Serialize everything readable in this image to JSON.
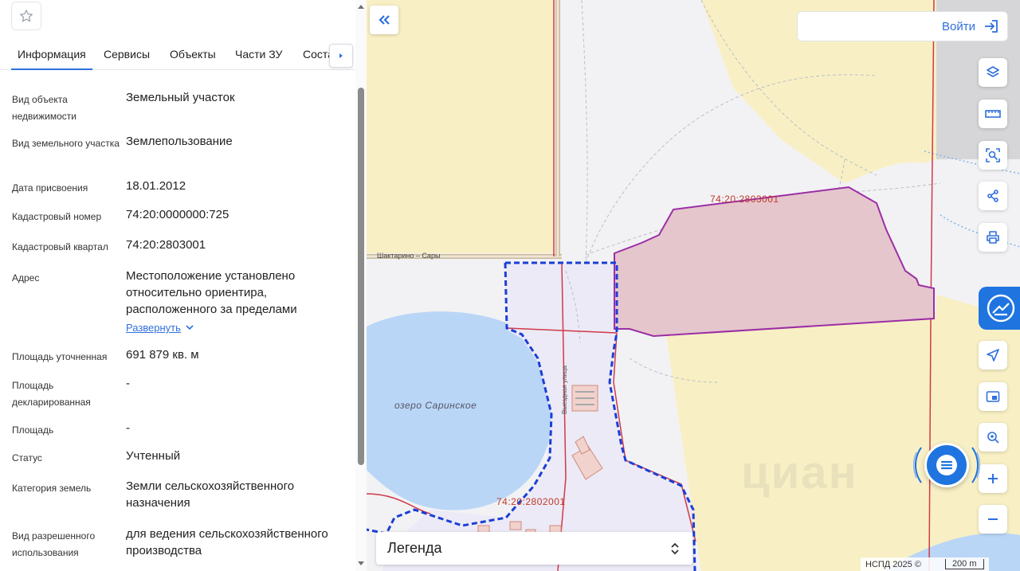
{
  "panel": {
    "tabs": [
      {
        "label": "Информация",
        "active": true
      },
      {
        "label": "Сервисы",
        "active": false
      },
      {
        "label": "Объекты",
        "active": false
      },
      {
        "label": "Части ЗУ",
        "active": false
      },
      {
        "label": "Соста",
        "active": false
      }
    ],
    "rows": [
      {
        "label": "Вид объекта недвижимости",
        "value": "Земельный участок"
      },
      {
        "label": "Вид земельного участка",
        "value": "Землепользование"
      },
      {
        "label": "Дата присвоения",
        "value": "18.01.2012"
      },
      {
        "label": "Кадастровый номер",
        "value": "74:20:0000000:725"
      },
      {
        "label": "Кадастровый квартал",
        "value": "74:20:2803001"
      },
      {
        "label": "Адрес",
        "value": "Местоположение установлено относительно ориентира, расположенного за пределами",
        "expand_label": "Развернуть"
      },
      {
        "label": "Площадь уточненная",
        "value": "691 879 кв. м"
      },
      {
        "label": "Площадь декларированная",
        "value": "-"
      },
      {
        "label": "Площадь",
        "value": "-"
      },
      {
        "label": "Статус",
        "value": "Учтенный"
      },
      {
        "label": "Категория земель",
        "value": "Земли сельскохозяйственного назначения"
      },
      {
        "label": "Вид разрешенного использования",
        "value": "для ведения сельскохозяйственного производства"
      }
    ]
  },
  "map": {
    "login_label": "Войти",
    "legend_label": "Легенда",
    "attribution": "НСПД 2025 ©",
    "scale_label": "200 m",
    "labels": {
      "quarter_top": "74:20:2803001",
      "quarter_bottom": "74:20:2802001",
      "lake": "озеро Саринское",
      "road": "Шактарино – Сары",
      "street": "Выездная улица"
    },
    "watermark": "циан",
    "toolbar": [
      "layers-icon",
      "ruler-icon",
      "area-select-icon",
      "share-icon",
      "print-icon",
      "locate-icon",
      "minimap-icon",
      "search-location-icon",
      "zoom-in-icon",
      "zoom-out-icon"
    ],
    "colors": {
      "parcel_fill": "#e5c6cc",
      "parcel_stroke": "#9b2ea6",
      "water": "#bad6f7",
      "farmland": "#f8f0c4",
      "accent": "#1f74e0",
      "dashed_boundary": "#1a3fd6",
      "red_line": "#d0394a"
    }
  }
}
